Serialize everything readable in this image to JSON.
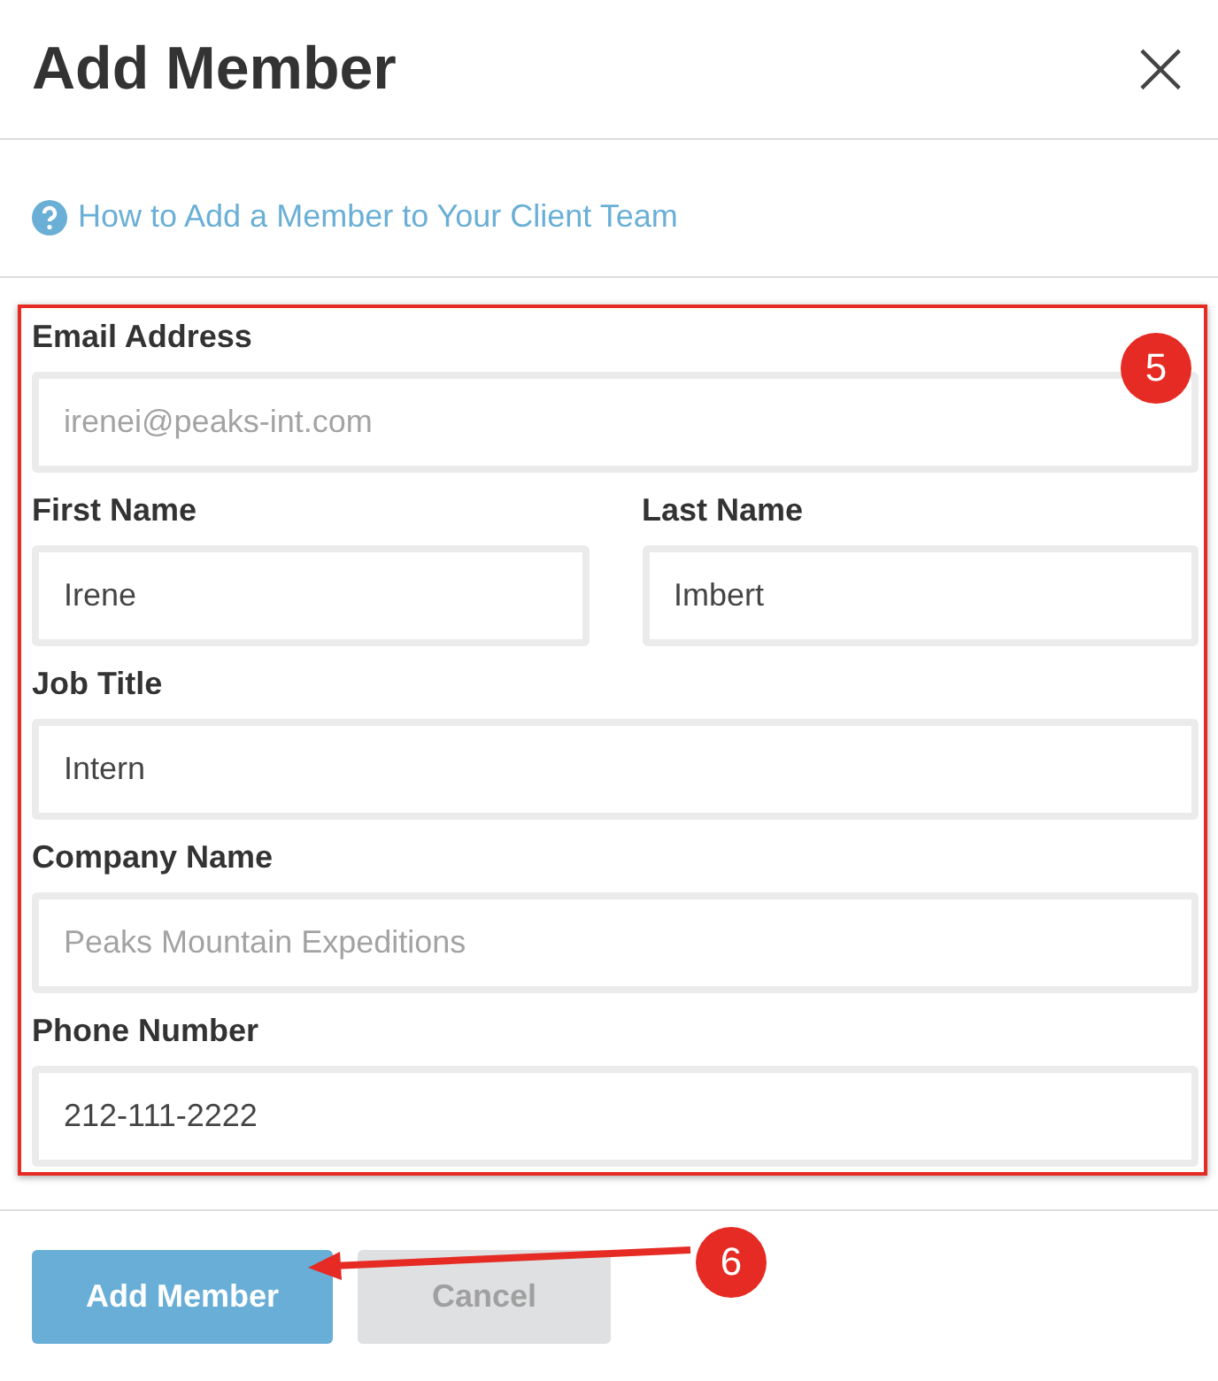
{
  "dialog": {
    "title": "Add Member",
    "close_glyph": "×"
  },
  "help_link": {
    "text": "How to Add a Member to Your Client Team"
  },
  "form": {
    "rows": [
      {
        "fields": [
          {
            "label": "Email Address",
            "value": "irenei@peaks-int.com",
            "disabled": true
          }
        ]
      },
      {
        "fields": [
          {
            "label": "First Name",
            "value": "Irene",
            "disabled": false
          },
          {
            "label": "Last Name",
            "value": "Imbert",
            "disabled": false
          }
        ]
      },
      {
        "fields": [
          {
            "label": "Job Title",
            "value": "Intern",
            "disabled": false
          }
        ]
      },
      {
        "fields": [
          {
            "label": "Company Name",
            "value": "Peaks Mountain Expeditions",
            "disabled": true
          }
        ]
      },
      {
        "fields": [
          {
            "label": "Phone Number",
            "value": "212-111-2222",
            "disabled": false
          }
        ]
      }
    ]
  },
  "buttons": [
    {
      "label": "Add Member",
      "kind": "primary",
      "disabled": false
    },
    {
      "label": "Cancel",
      "kind": "secondary",
      "disabled": true
    }
  ],
  "annotations": [
    {
      "kind": "box",
      "number": "5"
    },
    {
      "kind": "arrow",
      "number": "6"
    }
  ]
}
